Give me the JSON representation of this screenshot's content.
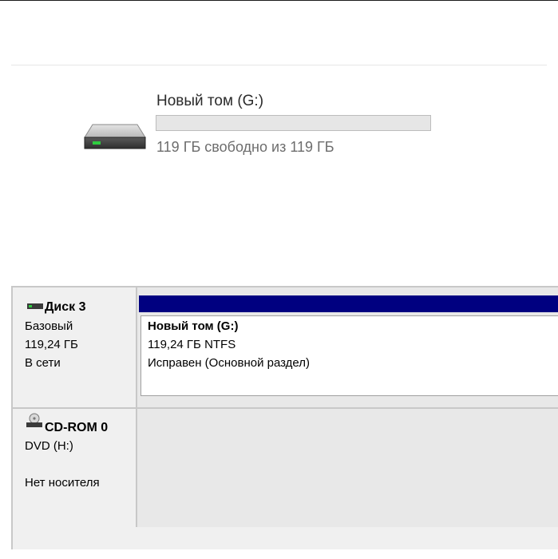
{
  "explorer": {
    "drive_name": "Новый том (G:)",
    "drive_free_text": "119 ГБ свободно из 119 ГБ",
    "used_fraction": 0.0,
    "icon": "hard-drive-icon"
  },
  "disk_management": {
    "disk3": {
      "title": "Диск 3",
      "type": "Базовый",
      "size": "119,24 ГБ",
      "status": "В сети",
      "icon": "disk-icon"
    },
    "partition": {
      "name": "Новый том  (G:)",
      "details": "119,24 ГБ NTFS",
      "health": "Исправен (Основной раздел)",
      "header_color": "#000080"
    },
    "cdrom": {
      "title": "CD-ROM 0",
      "drive": "DVD (H:)",
      "status": "Нет носителя",
      "icon": "cd-drive-icon"
    }
  }
}
